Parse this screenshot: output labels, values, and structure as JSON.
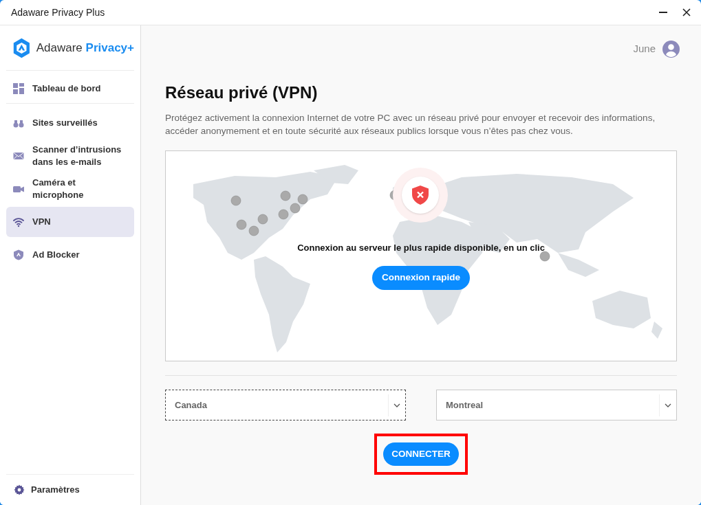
{
  "window": {
    "title": "Adaware Privacy Plus"
  },
  "brand": {
    "name": "Adaware",
    "suffix": "Privacy+"
  },
  "sidebar": {
    "items": [
      {
        "label": "Tableau de bord",
        "selected": false
      },
      {
        "label": "Sites surveillés",
        "selected": false
      },
      {
        "label": "Scanner d’intrusions dans les e-mails",
        "selected": false
      },
      {
        "label": "Caméra et microphone",
        "selected": false
      },
      {
        "label": "VPN",
        "selected": true
      },
      {
        "label": "Ad Blocker",
        "selected": false
      }
    ],
    "settings": "Paramètres"
  },
  "user": {
    "name": "June"
  },
  "page": {
    "title": "Réseau privé (VPN)",
    "description": "Protégez activement la connexion Internet de votre PC avec un réseau privé pour envoyer et recevoir des informations, accéder anonymement et en toute sécurité aux réseaux publics lorsque vous n’êtes pas chez vous."
  },
  "map": {
    "caption": "Connexion au serveur le plus rapide disponible, en un clic",
    "quick_button": "Connexion rapide",
    "connected": false
  },
  "selects": [
    {
      "value": "Canada",
      "focused": true
    },
    {
      "value": "Montreal",
      "focused": false
    }
  ],
  "connect_button": {
    "label": "CONNECTER",
    "highlighted": true
  }
}
